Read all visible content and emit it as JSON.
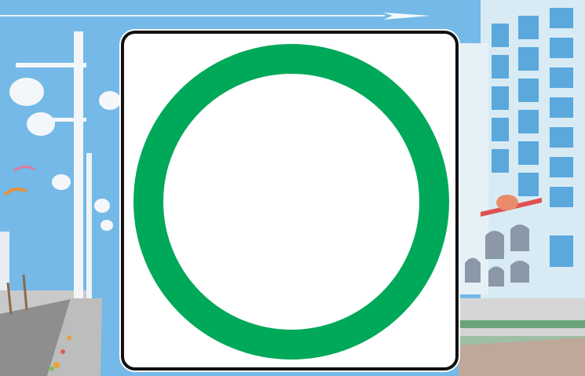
{
  "scene": {
    "description_colors": {
      "sky": "#73b8e6",
      "building": "#cfe6f2",
      "window": "#5aa9dd",
      "road": "#8d8d8d",
      "sidewalk": "#d9d9d9"
    }
  },
  "sign": {
    "background_color": "#ffffff",
    "border_color": "#111111",
    "ring_color": "#00a85a"
  }
}
